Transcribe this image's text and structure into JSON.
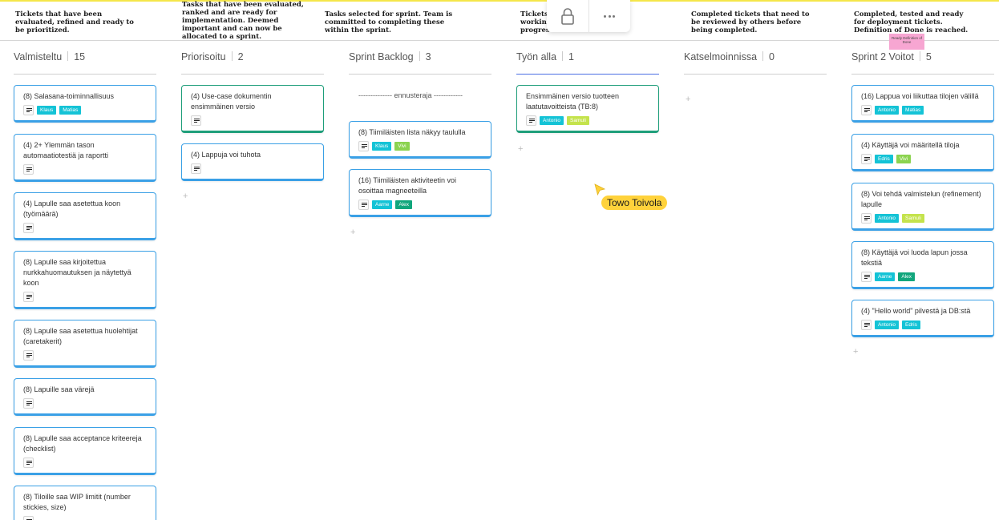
{
  "descriptions": [
    "Tickets that have been evaluated, refined and ready to be prioritized.",
    "Tasks that have been evaluated, ranked and are ready for implementation. Deemed important and can now be allocated to a sprint.",
    "Tasks selected for sprint. Team is committed to completing these within the sprint.",
    "Tickets working progress.",
    "Completed tickets that need to be reviewed by others before being completed.",
    "Completed, tested and ready for deployment tickets. Definition of Done is reached."
  ],
  "sticky_note": "Ready Definition of Done",
  "cursor": {
    "name": "Towo Toivola",
    "color": "#ffd23b"
  },
  "colors": {
    "Klaus": "#14c3d6",
    "Matias": "#14c3d6",
    "Antonio": "#14c3d6",
    "Edris": "#14c3d6",
    "Aarne": "#14c3d6",
    "Alex": "#11a67c",
    "Vivi": "#8bd34f",
    "Samuli": "#c4e34c"
  },
  "columns": [
    {
      "title": "Valmisteltu",
      "count": "15",
      "cards": [
        {
          "title": "(8) Salasana-toiminnallisuus",
          "tags": [
            "Klaus",
            "Matias"
          ]
        },
        {
          "title": "(4) 2+ Ylemmän tason automaatiotestiä ja raportti",
          "tags": []
        },
        {
          "title": "(4) Lapulle saa asetettua koon (työmäärä)",
          "tags": []
        },
        {
          "title": "(8) Lapulle saa kirjoitettua nurkkahuomautuksen ja näytettyä koon",
          "tags": []
        },
        {
          "title": "(8) Lapulle saa asetettua huolehtijat (caretakerit)",
          "tags": []
        },
        {
          "title": "(8) Lapuille saa värejä",
          "tags": []
        },
        {
          "title": "(8) Lapulle saa acceptance kriteereja (checklist)",
          "tags": []
        },
        {
          "title": "(8) Tiloille saa WIP limitit (number stickies, size)",
          "tags": []
        }
      ]
    },
    {
      "title": "Priorisoitu",
      "count": "2",
      "cards": [
        {
          "title": "(4) Use-case dokumentin ensimmäinen versio",
          "tags": []
        },
        {
          "title": "(4) Lappuja voi tuhota",
          "tags": []
        }
      ]
    },
    {
      "title": "Sprint Backlog",
      "count": "3",
      "divider": "-------------- ennusteraja ------------",
      "cards": [
        {
          "title": "(8) Tiimiläisten lista näkyy taululla",
          "tags": [
            "Klaus",
            "Vivi"
          ]
        },
        {
          "title": "(16) Tiimiläisten aktiviteetin voi osoittaa magneeteilla",
          "tags": [
            "Aarne",
            "Alex"
          ]
        }
      ]
    },
    {
      "title": "Työn alla",
      "count": "1",
      "cards": [
        {
          "title": "Ensimmäinen versio tuotteen laatutavoitteista (TB:8)",
          "tags": [
            "Antonio",
            "Samuli"
          ]
        }
      ]
    },
    {
      "title": "Katselmoinnissa",
      "count": "0",
      "cards": []
    },
    {
      "title": "Sprint 2 Voitot",
      "count": "5",
      "cards": [
        {
          "title": "(16) Lappua voi liikuttaa tilojen välillä",
          "tags": [
            "Antonio",
            "Matias"
          ]
        },
        {
          "title": "(4) Käyttäjä voi määritellä tiloja",
          "tags": [
            "Edris",
            "Vivi"
          ]
        },
        {
          "title": "(8) Voi tehdä valmistelun (refinement) lapulle",
          "tags": [
            "Antonio",
            "Samuli"
          ]
        },
        {
          "title": "(8) Käyttäjä voi luoda lapun jossa tekstiä",
          "tags": [
            "Aarne",
            "Alex"
          ]
        },
        {
          "title": "(4) \"Hello world\" pilvestä ja DB:stä",
          "tags": [
            "Antonio",
            "Edris"
          ]
        }
      ]
    }
  ],
  "add_symbol": "+"
}
